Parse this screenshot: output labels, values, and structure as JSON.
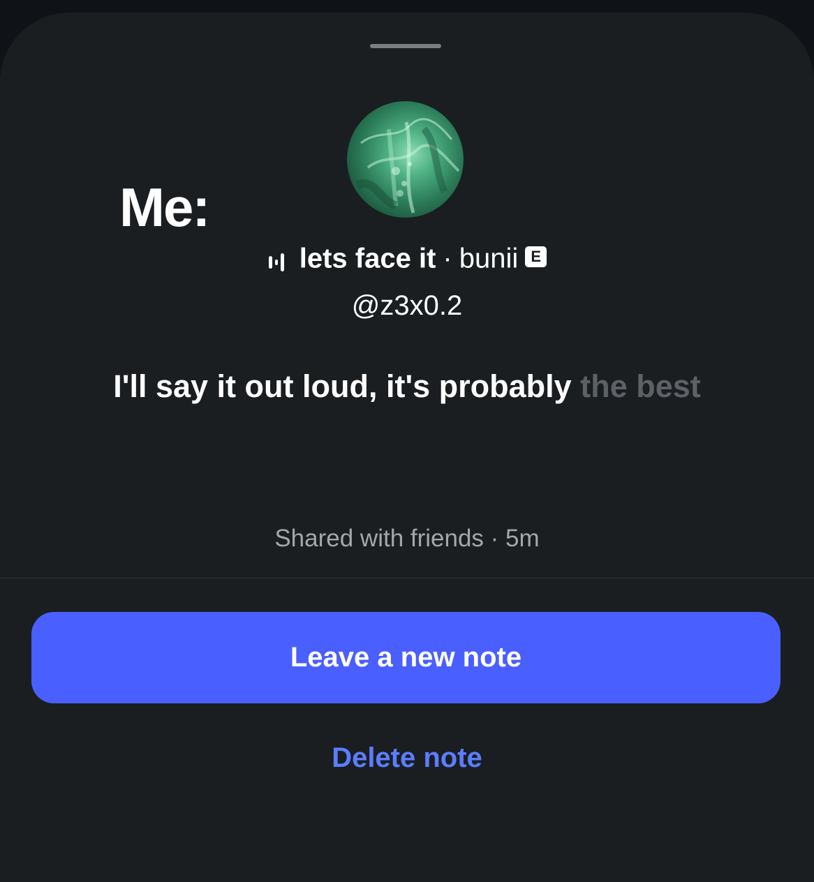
{
  "overlay_caption": "Me:",
  "note": {
    "avatar": "profile-photo",
    "music": {
      "icon": "audio-wave-icon",
      "title": "lets face it",
      "separator": "·",
      "artist": "bunii",
      "explicit_badge": "E"
    },
    "username": "@z3x0.2",
    "lyric": {
      "active": "I'll say it out loud, it's probably",
      "upcoming": "the best"
    },
    "status": "Shared with friends · 5m"
  },
  "actions": {
    "primary_label": "Leave a new note",
    "secondary_label": "Delete note"
  },
  "colors": {
    "sheet_background": "#1a1e21",
    "primary_button": "#4a5fff",
    "link": "#5b7dff",
    "muted_text": "#a3a8ad"
  }
}
